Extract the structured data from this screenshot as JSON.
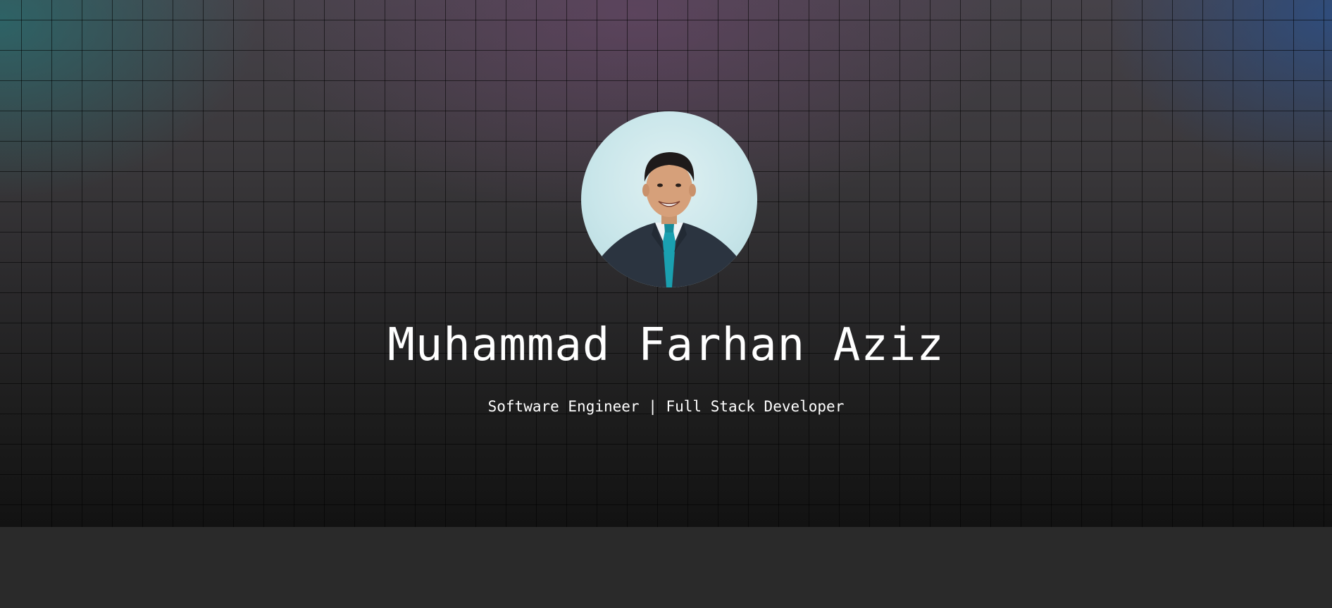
{
  "hero": {
    "name": "Muhammad Farhan Aziz",
    "subtitle": "Software Engineer | Full Stack Developer",
    "avatar_alt": "Profile photo of Muhammad Farhan Aziz"
  },
  "colors": {
    "text": "#ffffff",
    "background_bottom": "#2a2a2a",
    "accent_teal": "#266e70",
    "accent_purple": "#6e466e",
    "accent_blue": "#28508c"
  }
}
